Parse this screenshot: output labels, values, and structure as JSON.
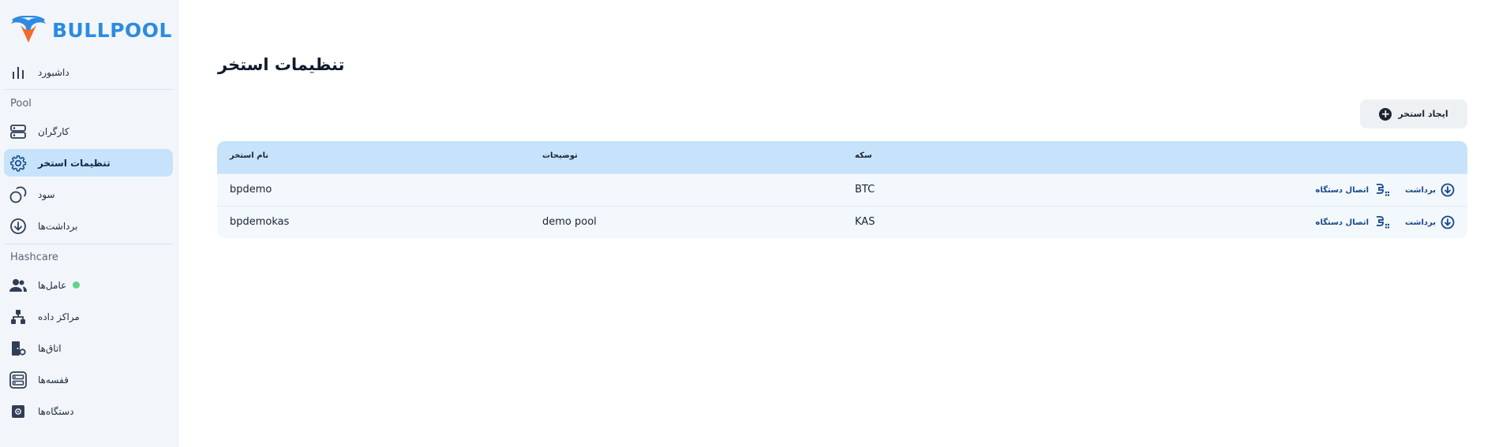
{
  "brand": {
    "name": "BULLPOOL"
  },
  "sidebar": {
    "dashboard": "داشبورد",
    "section_pool": "Pool",
    "workers": "کارگران",
    "pool_settings": "تنظیمات استخر",
    "profit": "سود",
    "withdrawals": "برداشت‌ها",
    "section_hashcare": "Hashcare",
    "agents": "عامل‌ها",
    "datacenters": "مراکز داده",
    "rooms": "اتاق‌ها",
    "racks": "قفسه‌ها",
    "devices": "دستگاه‌ها"
  },
  "main": {
    "title": "تنظیمات استخر",
    "create_button": "ایجاد استخر",
    "columns": {
      "name": "نام استخر",
      "description": "توضیحات",
      "coin": "سکه"
    },
    "rows": [
      {
        "name": "bpdemo",
        "description": "",
        "coin": "BTC",
        "connect": "اتصال دستگاه",
        "withdraw": "برداشت"
      },
      {
        "name": "bpdemokas",
        "description": "demo pool",
        "coin": "KAS",
        "connect": "اتصال دستگاه",
        "withdraw": "برداشت"
      }
    ]
  },
  "colors": {
    "brand": "#2c8be0",
    "active_bg": "#c7e2fb",
    "agent_status": "#5fd38a",
    "action": "#17478a"
  }
}
